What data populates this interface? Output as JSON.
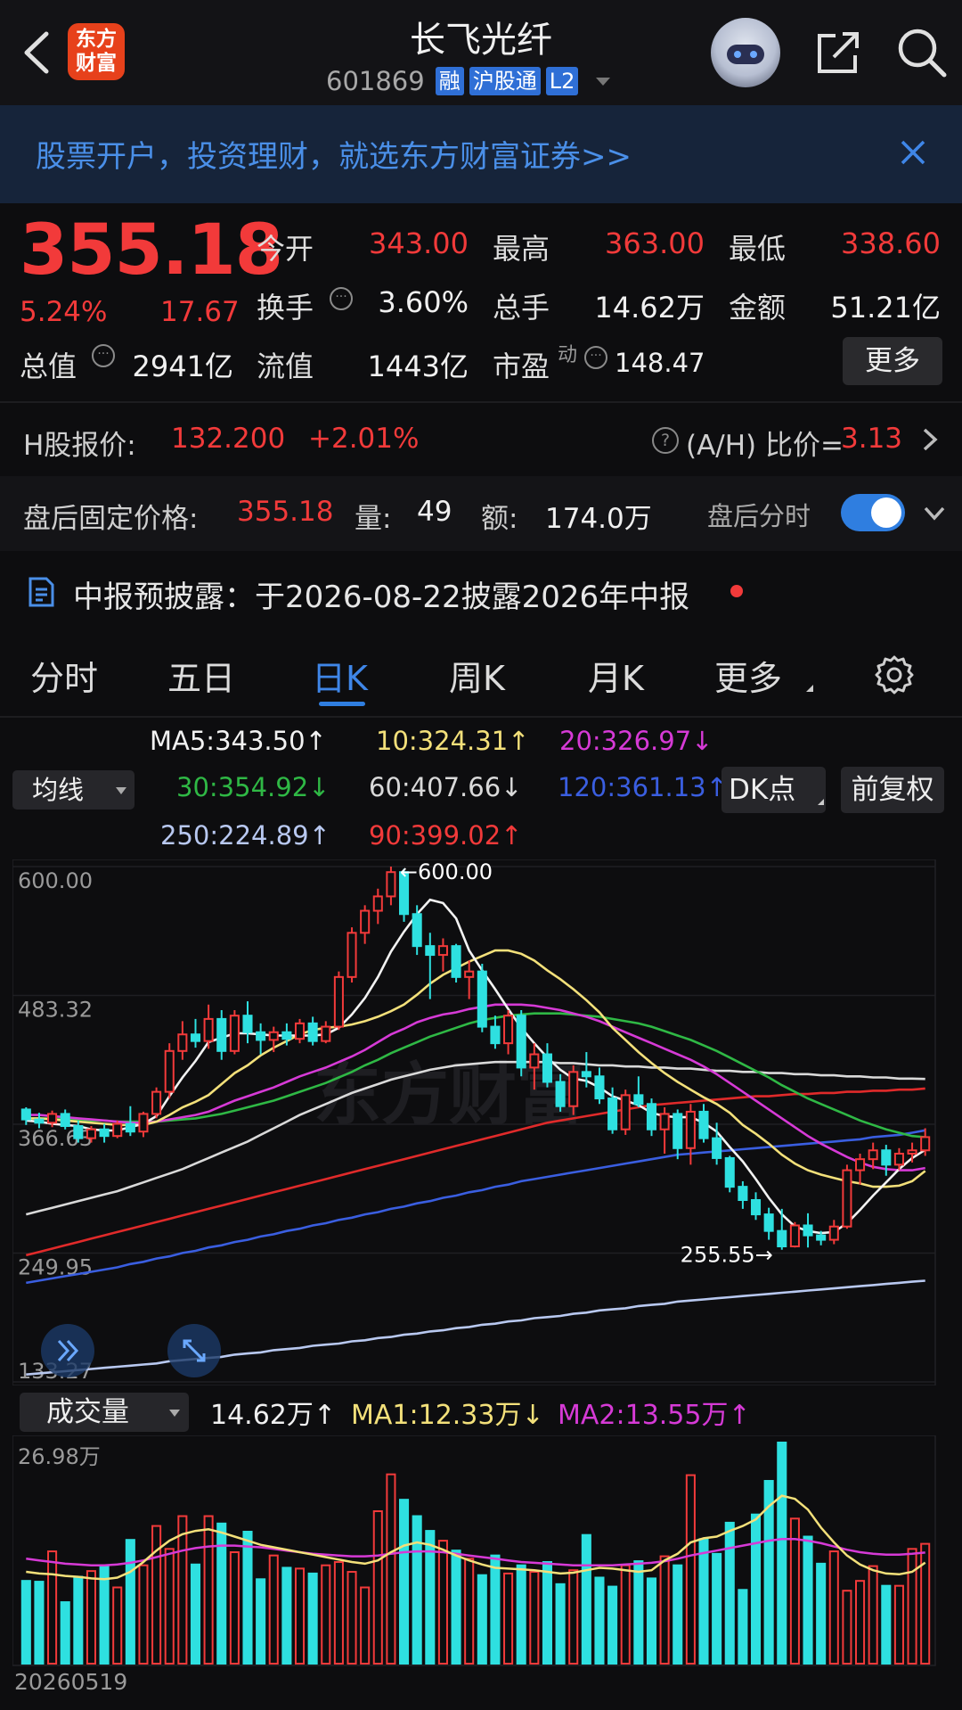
{
  "header": {
    "logo_line1": "东方",
    "logo_line2": "财富",
    "stock_name": "长飞光纤",
    "stock_code": "601869",
    "tags": [
      "融",
      "沪股通",
      "L2"
    ]
  },
  "ad": {
    "text": "股票开户，投资理财，就选东方财富证券>>"
  },
  "quote": {
    "price": "355.18",
    "change_pct": "5.24%",
    "change_amt": "17.67",
    "open_label": "今开",
    "open": "343.00",
    "high_label": "最高",
    "high": "363.00",
    "low_label": "最低",
    "low": "338.60",
    "turnover_label": "换手",
    "turnover": "3.60%",
    "volume_label": "总手",
    "volume": "14.62万",
    "amount_label": "金额",
    "amount": "51.21亿",
    "total_cap_label": "总值",
    "total_cap": "2941亿",
    "float_cap_label": "流值",
    "float_cap": "1443亿",
    "pe_label": "市盈",
    "pe_sup": "动",
    "pe": "148.47",
    "more_label": "更多"
  },
  "hshare": {
    "label": "H股报价:",
    "price": "132.200",
    "change": "+2.01%",
    "ratio_label": "(A/H) 比价=",
    "ratio": "3.13"
  },
  "after_hours": {
    "label": "盘后固定价格:",
    "price": "355.18",
    "vol_label": "量:",
    "vol": "49",
    "amt_label": "额:",
    "amt": "174.0万",
    "intraday_label": "盘后分时",
    "toggle_on": true
  },
  "notice": {
    "text": "中报预披露：于2026-08-22披露2026年中报"
  },
  "tabs": [
    "分时",
    "五日",
    "日K",
    "周K",
    "月K",
    "更多"
  ],
  "active_tab": "日K",
  "ma_select": "均线",
  "ma_legend": {
    "ma5": "MA5:343.50↑",
    "ma10": "10:324.31↑",
    "ma20": "20:326.97↓",
    "ma30": "30:354.92↓",
    "ma60": "60:407.66↓",
    "ma120": "120:361.13↑",
    "ma250": "250:224.89↑",
    "ma90": "90:399.02↑"
  },
  "dk_button": "DK点",
  "fq_button": "前复权",
  "colors": {
    "up": "#f23a3a",
    "down": "#2ee0e0",
    "ma5": "#f2f2f2",
    "ma10": "#f3e07a",
    "ma20": "#d63ad6",
    "ma30": "#2fb845",
    "ma60": "#d9d9d9",
    "ma120": "#3a5ee0",
    "ma250": "#b8c8f0",
    "ma90": "#e02a2a",
    "accent": "#2f7ee0"
  },
  "chart_data": {
    "type": "candlestick",
    "y_axis_labels": [
      "600.00",
      "483.32",
      "366.63",
      "249.95",
      "133.27"
    ],
    "ylim": [
      133.27,
      600.0
    ],
    "annotations": {
      "max_label": "←600.00",
      "min_label": "255.55→"
    },
    "watermark": "东方财富",
    "candles": [
      [
        380,
        382,
        366,
        371
      ],
      [
        371,
        377,
        363,
        368
      ],
      [
        368,
        379,
        364,
        376
      ],
      [
        376,
        380,
        362,
        365
      ],
      [
        365,
        370,
        350,
        354
      ],
      [
        354,
        365,
        350,
        362
      ],
      [
        362,
        367,
        350,
        356
      ],
      [
        356,
        370,
        354,
        367
      ],
      [
        367,
        383,
        356,
        360
      ],
      [
        360,
        378,
        355,
        376
      ],
      [
        376,
        400,
        372,
        396
      ],
      [
        396,
        440,
        390,
        433
      ],
      [
        433,
        460,
        425,
        448
      ],
      [
        448,
        462,
        436,
        442
      ],
      [
        442,
        475,
        435,
        462
      ],
      [
        462,
        470,
        425,
        433
      ],
      [
        433,
        470,
        430,
        465
      ],
      [
        465,
        478,
        440,
        450
      ],
      [
        450,
        458,
        430,
        443
      ],
      [
        443,
        455,
        432,
        450
      ],
      [
        450,
        458,
        438,
        444
      ],
      [
        444,
        462,
        440,
        458
      ],
      [
        458,
        464,
        438,
        442
      ],
      [
        442,
        460,
        440,
        455
      ],
      [
        455,
        505,
        452,
        500
      ],
      [
        500,
        545,
        495,
        540
      ],
      [
        540,
        565,
        530,
        560
      ],
      [
        560,
        580,
        548,
        573
      ],
      [
        573,
        600,
        565,
        595
      ],
      [
        595,
        598,
        550,
        557
      ],
      [
        557,
        565,
        520,
        528
      ],
      [
        528,
        540,
        480,
        520
      ],
      [
        520,
        535,
        505,
        528
      ],
      [
        528,
        530,
        495,
        500
      ],
      [
        500,
        515,
        480,
        505
      ],
      [
        505,
        512,
        450,
        455
      ],
      [
        455,
        465,
        435,
        440
      ],
      [
        440,
        470,
        430,
        465
      ],
      [
        465,
        470,
        410,
        418
      ],
      [
        418,
        440,
        398,
        430
      ],
      [
        430,
        440,
        400,
        405
      ],
      [
        405,
        412,
        378,
        383
      ],
      [
        383,
        420,
        375,
        414
      ],
      [
        414,
        432,
        400,
        410
      ],
      [
        410,
        418,
        385,
        390
      ],
      [
        390,
        400,
        358,
        362
      ],
      [
        362,
        398,
        357,
        393
      ],
      [
        393,
        410,
        382,
        385
      ],
      [
        385,
        390,
        356,
        362
      ],
      [
        362,
        382,
        340,
        376
      ],
      [
        376,
        380,
        335,
        345
      ],
      [
        345,
        385,
        330,
        378
      ],
      [
        378,
        385,
        350,
        354
      ],
      [
        354,
        368,
        330,
        336
      ],
      [
        336,
        338,
        305,
        310
      ],
      [
        310,
        315,
        290,
        298
      ],
      [
        298,
        305,
        280,
        285
      ],
      [
        285,
        291,
        262,
        270
      ],
      [
        270,
        290,
        253,
        256
      ],
      [
        256,
        278,
        255,
        275
      ],
      [
        275,
        286,
        255,
        266
      ],
      [
        266,
        270,
        257,
        262
      ],
      [
        262,
        280,
        258,
        274
      ],
      [
        274,
        330,
        272,
        325
      ],
      [
        325,
        340,
        312,
        335
      ],
      [
        335,
        350,
        326,
        343
      ],
      [
        343,
        348,
        320,
        330
      ],
      [
        330,
        345,
        325,
        340
      ],
      [
        340,
        350,
        332,
        343
      ],
      [
        343,
        363,
        338,
        355
      ]
    ],
    "ma_series": {
      "MA5": [
        370,
        369,
        367,
        366,
        365,
        362,
        361,
        361,
        364,
        367,
        374,
        392,
        409,
        424,
        441,
        445,
        449,
        449,
        448,
        447,
        447,
        447,
        447,
        448,
        454,
        466,
        481,
        500,
        523,
        541,
        557,
        570,
        567,
        553,
        524,
        506,
        489,
        471,
        454,
        440,
        427,
        416,
        408,
        406,
        400,
        392,
        388,
        384,
        377,
        374,
        373,
        373,
        368,
        360,
        346,
        333,
        317,
        300,
        285,
        274,
        270,
        268,
        269,
        277,
        289,
        302,
        314,
        326,
        336,
        343.5
      ],
      "MA10": [
        372,
        372,
        371,
        370,
        369,
        368,
        367,
        366,
        366,
        366,
        369,
        375,
        382,
        387,
        393,
        403,
        413,
        420,
        429,
        436,
        442,
        448,
        452,
        454,
        455,
        457,
        460,
        464,
        469,
        475,
        484,
        494,
        502,
        508,
        514,
        519,
        524,
        524,
        521,
        515,
        506,
        498,
        489,
        479,
        468,
        454,
        443,
        432,
        422,
        413,
        405,
        398,
        391,
        385,
        377,
        366,
        358,
        349,
        339,
        331,
        325,
        321,
        318,
        315,
        313,
        310,
        310,
        311,
        315,
        324.31
      ],
      "MA20": [
        375,
        375,
        374,
        373,
        372,
        371,
        370,
        369,
        368,
        368,
        369,
        371,
        373,
        375,
        378,
        383,
        388,
        392,
        396,
        400,
        405,
        410,
        414,
        418,
        423,
        428,
        434,
        441,
        448,
        453,
        459,
        463,
        466,
        468,
        471,
        473,
        475,
        475,
        475,
        474,
        472,
        470,
        467,
        464,
        460,
        455,
        450,
        445,
        440,
        435,
        430,
        425,
        419,
        412,
        404,
        396,
        388,
        380,
        372,
        364,
        356,
        349,
        343,
        337,
        332,
        328,
        326,
        325,
        325,
        326.97
      ],
      "MA30": [
        372,
        372,
        372,
        371,
        371,
        370,
        370,
        369,
        369,
        369,
        369,
        370,
        371,
        372,
        374,
        376,
        379,
        382,
        385,
        388,
        392,
        396,
        400,
        404,
        409,
        414,
        420,
        425,
        431,
        436,
        441,
        446,
        450,
        454,
        458,
        461,
        463,
        465,
        466,
        467,
        467,
        467,
        466,
        465,
        464,
        462,
        460,
        458,
        455,
        451,
        447,
        443,
        438,
        433,
        427,
        421,
        415,
        409,
        402,
        396,
        390,
        385,
        380,
        375,
        370,
        366,
        362,
        359,
        356,
        354.92
      ],
      "MA60": [
        285,
        288,
        291,
        294,
        297,
        300,
        303,
        306,
        310,
        314,
        318,
        322,
        326,
        331,
        336,
        341,
        346,
        351,
        357,
        363,
        369,
        375,
        380,
        385,
        390,
        395,
        399,
        403,
        407,
        410,
        413,
        416,
        418,
        420,
        421,
        422,
        423,
        423,
        423,
        423,
        423,
        422,
        422,
        421,
        420,
        420,
        419,
        419,
        418,
        418,
        417,
        417,
        416,
        415,
        415,
        414,
        414,
        413,
        413,
        412,
        412,
        411,
        411,
        410,
        410,
        409,
        409,
        408,
        408,
        407.66
      ],
      "MA120": [
        223,
        225,
        227,
        229,
        231,
        233,
        235,
        237,
        240,
        242,
        245,
        247,
        250,
        252,
        255,
        257,
        260,
        262,
        265,
        267,
        270,
        272,
        275,
        277,
        280,
        282,
        285,
        287,
        290,
        292,
        295,
        297,
        300,
        302,
        305,
        307,
        310,
        312,
        315,
        317,
        319,
        321,
        323,
        325,
        327,
        329,
        331,
        333,
        335,
        337,
        339,
        340,
        341,
        342,
        343,
        344,
        345,
        346,
        347,
        348,
        349,
        350,
        351,
        352,
        353,
        355,
        356,
        357,
        359,
        361.13
      ],
      "MA250": [
        140,
        141,
        142,
        143,
        144,
        145,
        146,
        147,
        148,
        149,
        150,
        152,
        153,
        154,
        155,
        156,
        158,
        159,
        160,
        162,
        163,
        164,
        166,
        167,
        168,
        170,
        171,
        173,
        174,
        176,
        177,
        179,
        180,
        182,
        183,
        185,
        186,
        188,
        189,
        191,
        192,
        193,
        195,
        196,
        198,
        199,
        200,
        202,
        203,
        204,
        206,
        207,
        208,
        209,
        210,
        211,
        212,
        213,
        214,
        215,
        216,
        217,
        218,
        219,
        220,
        221,
        222,
        223,
        224,
        224.89
      ],
      "MA90": [
        248,
        251,
        254,
        257,
        260,
        263,
        266,
        269,
        272,
        275,
        278,
        281,
        284,
        287,
        290,
        293,
        296,
        299,
        302,
        305,
        308,
        311,
        314,
        317,
        320,
        323,
        326,
        329,
        332,
        335,
        338,
        341,
        344,
        347,
        350,
        353,
        356,
        359,
        362,
        365,
        368,
        370,
        372,
        374,
        376,
        378,
        380,
        382,
        384,
        385,
        386,
        387,
        388,
        389,
        390,
        391,
        392,
        392,
        393,
        394,
        394,
        395,
        395,
        396,
        396,
        397,
        397,
        398,
        398,
        399.02
      ]
    },
    "volume": {
      "select_label": "成交量",
      "current": "14.62万↑",
      "ma1_label": "MA1:12.33万↓",
      "ma2_label": "MA2:13.55万↑",
      "max_label": "26.98万",
      "ylim": [
        0,
        26.98
      ],
      "values": [
        10.1,
        10.0,
        13.7,
        7.5,
        10.6,
        11.3,
        12.0,
        9.3,
        15.1,
        12.0,
        16.8,
        14.0,
        18.0,
        12.1,
        18.0,
        17.1,
        13.6,
        16.1,
        10.3,
        13.2,
        11.7,
        11.6,
        11.0,
        12.0,
        12.4,
        11.2,
        9.3,
        18.6,
        23.1,
        20.0,
        18.0,
        16.2,
        15.0,
        13.8,
        12.8,
        10.8,
        13.2,
        11.0,
        12.0,
        11.2,
        12.4,
        9.7,
        11.4,
        15.7,
        10.5,
        9.4,
        12.0,
        12.5,
        10.4,
        13.1,
        12.0,
        23.0,
        15.2,
        13.4,
        17.2,
        9.0,
        18.2,
        22.3,
        26.98,
        17.7,
        15.5,
        12.2,
        13.7,
        8.9,
        10.1,
        11.9,
        9.5,
        9.5,
        14.0,
        14.62
      ],
      "ma1": [
        11.2,
        11.0,
        10.9,
        10.7,
        10.6,
        10.4,
        10.3,
        10.5,
        11.2,
        12.4,
        13.8,
        15.0,
        15.8,
        16.2,
        16.4,
        16.0,
        15.5,
        15.0,
        14.5,
        14.2,
        13.9,
        13.6,
        13.3,
        13.0,
        12.7,
        12.4,
        12.2,
        12.6,
        13.6,
        14.4,
        14.8,
        14.5,
        13.9,
        13.2,
        12.6,
        12.1,
        11.7,
        11.6,
        11.5,
        11.4,
        11.2,
        11.0,
        11.1,
        11.4,
        11.7,
        11.6,
        11.4,
        11.2,
        11.4,
        12.6,
        13.4,
        14.8,
        15.3,
        15.5,
        16.2,
        16.8,
        17.6,
        19.2,
        20.5,
        20.1,
        18.8,
        16.6,
        14.8,
        13.2,
        12.1,
        11.4,
        11.0,
        10.9,
        11.2,
        12.33
      ],
      "ma2": [
        12.8,
        12.6,
        12.4,
        12.2,
        12.1,
        12.0,
        12.0,
        12.1,
        12.3,
        12.6,
        13.0,
        13.4,
        13.8,
        14.1,
        14.3,
        14.4,
        14.4,
        14.3,
        14.2,
        14.0,
        13.8,
        13.6,
        13.4,
        13.3,
        13.2,
        13.1,
        13.1,
        13.2,
        13.4,
        13.6,
        13.7,
        13.7,
        13.6,
        13.4,
        13.2,
        13.0,
        12.8,
        12.6,
        12.4,
        12.3,
        12.2,
        12.1,
        12.0,
        12.0,
        12.0,
        12.0,
        12.1,
        12.2,
        12.3,
        12.5,
        12.8,
        13.2,
        13.5,
        13.8,
        14.1,
        14.4,
        14.7,
        15.0,
        15.2,
        15.2,
        15.0,
        14.7,
        14.3,
        13.9,
        13.6,
        13.4,
        13.3,
        13.3,
        13.4,
        13.55
      ]
    },
    "x_start_label": "20260519"
  }
}
